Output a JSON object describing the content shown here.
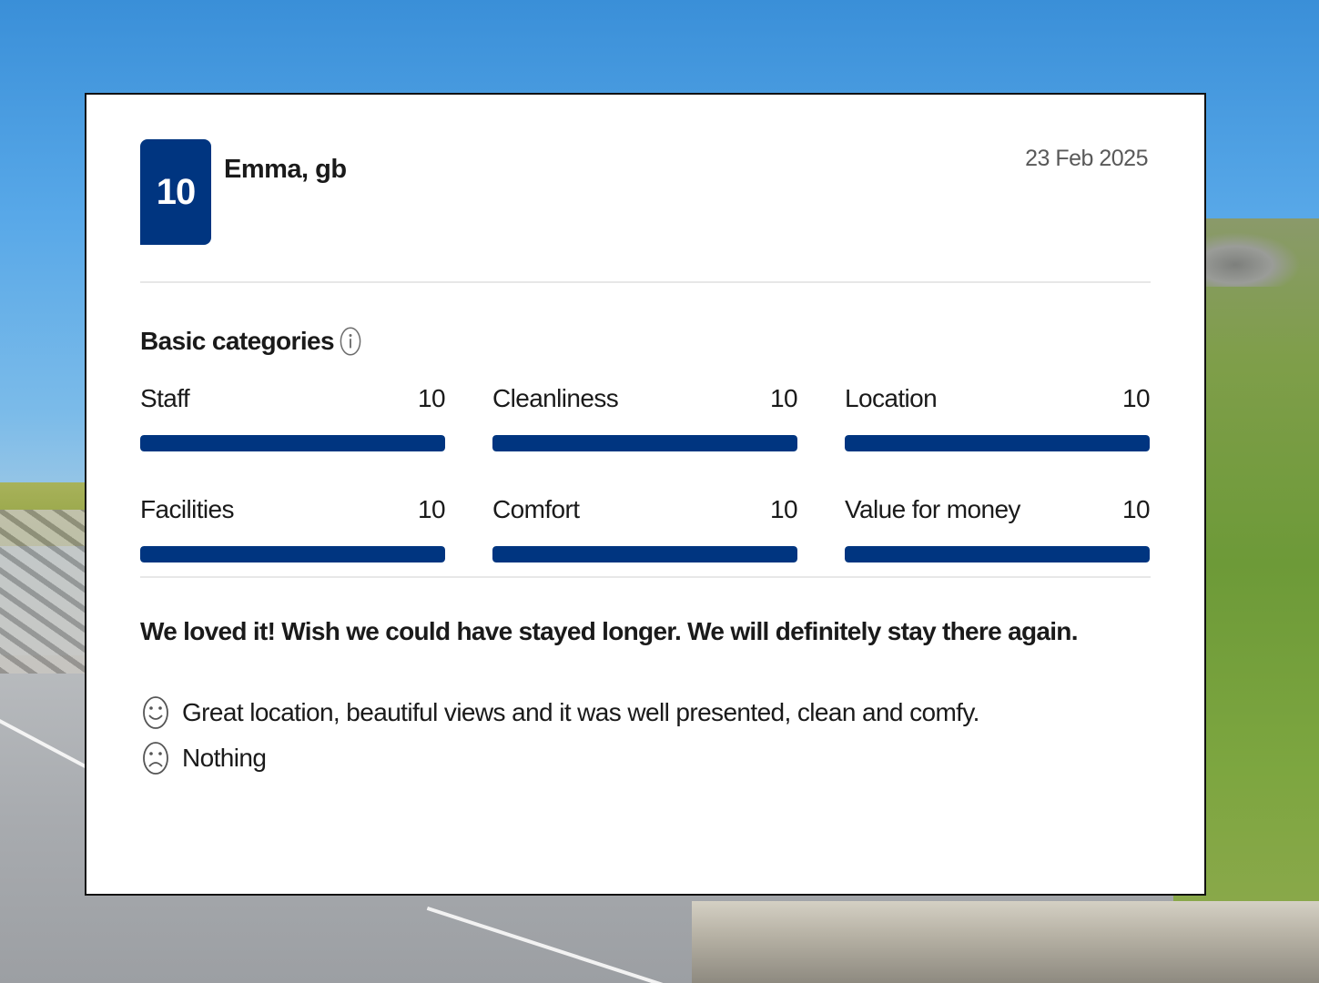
{
  "review": {
    "score": "10",
    "reviewer": "Emma, gb",
    "date": "23 Feb 2025",
    "section_title": "Basic categories",
    "categories": [
      {
        "label": "Staff",
        "score": "10",
        "fraction": 1.0
      },
      {
        "label": "Cleanliness",
        "score": "10",
        "fraction": 1.0
      },
      {
        "label": "Location",
        "score": "10",
        "fraction": 1.0
      },
      {
        "label": "Facilities",
        "score": "10",
        "fraction": 1.0
      },
      {
        "label": "Comfort",
        "score": "10",
        "fraction": 1.0
      },
      {
        "label": "Value for money",
        "score": "10",
        "fraction": 1.0
      }
    ],
    "headline": "We loved it! Wish we could have stayed longer. We will definitely stay there again.",
    "positive": "Great location, beautiful views and it was well presented, clean and comfy.",
    "negative": "Nothing"
  },
  "icons": {
    "info": "info-icon",
    "positive": "smiley-face-icon",
    "negative": "sad-face-icon"
  },
  "colors": {
    "accent": "#003580",
    "bar_track": "#e7e7e7",
    "text": "#1a1a1a",
    "muted": "#595959"
  }
}
